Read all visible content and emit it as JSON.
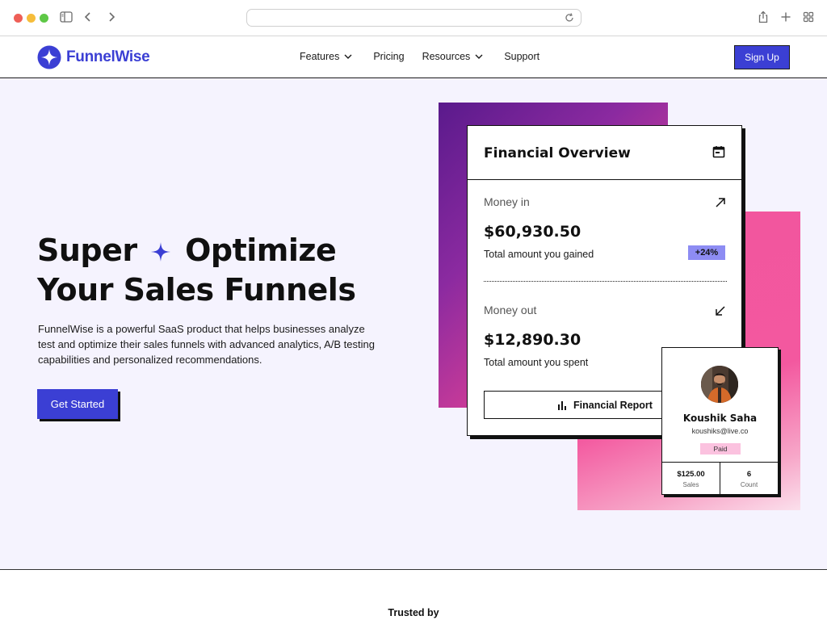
{
  "nav": {
    "brand": "FunnelWise",
    "items": [
      {
        "label": "Features",
        "has_dropdown": true
      },
      {
        "label": "Pricing",
        "has_dropdown": false
      },
      {
        "label": "Resources",
        "has_dropdown": true
      },
      {
        "label": "Support",
        "has_dropdown": false
      }
    ],
    "signup_label": "Sign Up"
  },
  "hero": {
    "headline_part1": "Super",
    "headline_part2": "Optimize",
    "headline_line2": "Your Sales Funnels",
    "description": "FunnelWise is a powerful SaaS product that helps businesses analyze test and optimize their sales funnels with advanced analytics, A/B testing capabilities and personalized recommendations.",
    "cta_label": "Get Started"
  },
  "financial_card": {
    "title": "Financial Overview",
    "money_in": {
      "label": "Money in",
      "amount": "$60,930.50",
      "caption": "Total amount you gained",
      "badge": "+24%"
    },
    "money_out": {
      "label": "Money out",
      "amount": "$12,890.30",
      "caption": "Total amount you spent"
    },
    "report_button": "Financial Report"
  },
  "profile_card": {
    "name": "Koushik Saha",
    "email": "koushiks@live.co",
    "status": "Paid",
    "stats": [
      {
        "value": "$125.00",
        "label": "Sales"
      },
      {
        "value": "6",
        "label": "Count"
      }
    ]
  },
  "footer": {
    "trusted_label": "Trusted by"
  },
  "colors": {
    "brand": "#3b3fd4",
    "hero_bg": "#f5f3fe",
    "accent_pink": "#f2559e",
    "badge": "#8d8cf3"
  },
  "icons": [
    "sidebar-icon",
    "back-icon",
    "forward-icon",
    "reload-icon",
    "share-icon",
    "new-tab-icon",
    "tabs-overview-icon",
    "sparkle-icon",
    "chevron-down-icon",
    "calendar-icon",
    "arrow-up-right-icon",
    "arrow-down-left-icon",
    "bar-chart-icon"
  ]
}
